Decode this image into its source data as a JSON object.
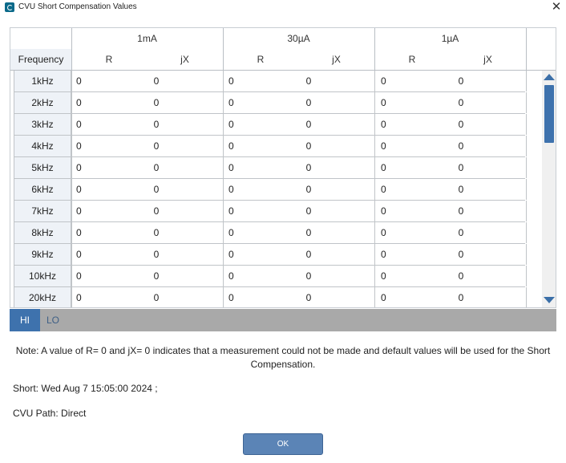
{
  "window": {
    "title": "CVU Short Compensation Values",
    "close_symbol": "✕"
  },
  "table": {
    "frequency_header": "Frequency",
    "groups": [
      {
        "label": "1mA",
        "r_label": "R",
        "jx_label": "jX"
      },
      {
        "label": "30µA",
        "r_label": "R",
        "jx_label": "jX"
      },
      {
        "label": "1µA",
        "r_label": "R",
        "jx_label": "jX"
      }
    ],
    "rows": [
      {
        "freq": "1kHz",
        "values": [
          "0",
          "0",
          "0",
          "0",
          "0",
          "0"
        ]
      },
      {
        "freq": "2kHz",
        "values": [
          "0",
          "0",
          "0",
          "0",
          "0",
          "0"
        ]
      },
      {
        "freq": "3kHz",
        "values": [
          "0",
          "0",
          "0",
          "0",
          "0",
          "0"
        ]
      },
      {
        "freq": "4kHz",
        "values": [
          "0",
          "0",
          "0",
          "0",
          "0",
          "0"
        ]
      },
      {
        "freq": "5kHz",
        "values": [
          "0",
          "0",
          "0",
          "0",
          "0",
          "0"
        ]
      },
      {
        "freq": "6kHz",
        "values": [
          "0",
          "0",
          "0",
          "0",
          "0",
          "0"
        ]
      },
      {
        "freq": "7kHz",
        "values": [
          "0",
          "0",
          "0",
          "0",
          "0",
          "0"
        ]
      },
      {
        "freq": "8kHz",
        "values": [
          "0",
          "0",
          "0",
          "0",
          "0",
          "0"
        ]
      },
      {
        "freq": "9kHz",
        "values": [
          "0",
          "0",
          "0",
          "0",
          "0",
          "0"
        ]
      },
      {
        "freq": "10kHz",
        "values": [
          "0",
          "0",
          "0",
          "0",
          "0",
          "0"
        ]
      },
      {
        "freq": "20kHz",
        "values": [
          "0",
          "0",
          "0",
          "0",
          "0",
          "0"
        ]
      }
    ]
  },
  "tabs": [
    {
      "label": "HI",
      "active": true
    },
    {
      "label": "LO",
      "active": false
    }
  ],
  "note": "Note: A value of R= 0 and jX= 0 indicates that a measurement could not be made and default values will be used for the Short Compensation.",
  "short_info": "Short: Wed Aug  7 15:05:00 2024 ;",
  "cvu_path": "CVU Path: Direct",
  "ok_label": "OK",
  "colors": {
    "accent": "#3e72ad",
    "tab_bar": "#a9a9a9",
    "freq_column": "#eef2f7"
  }
}
